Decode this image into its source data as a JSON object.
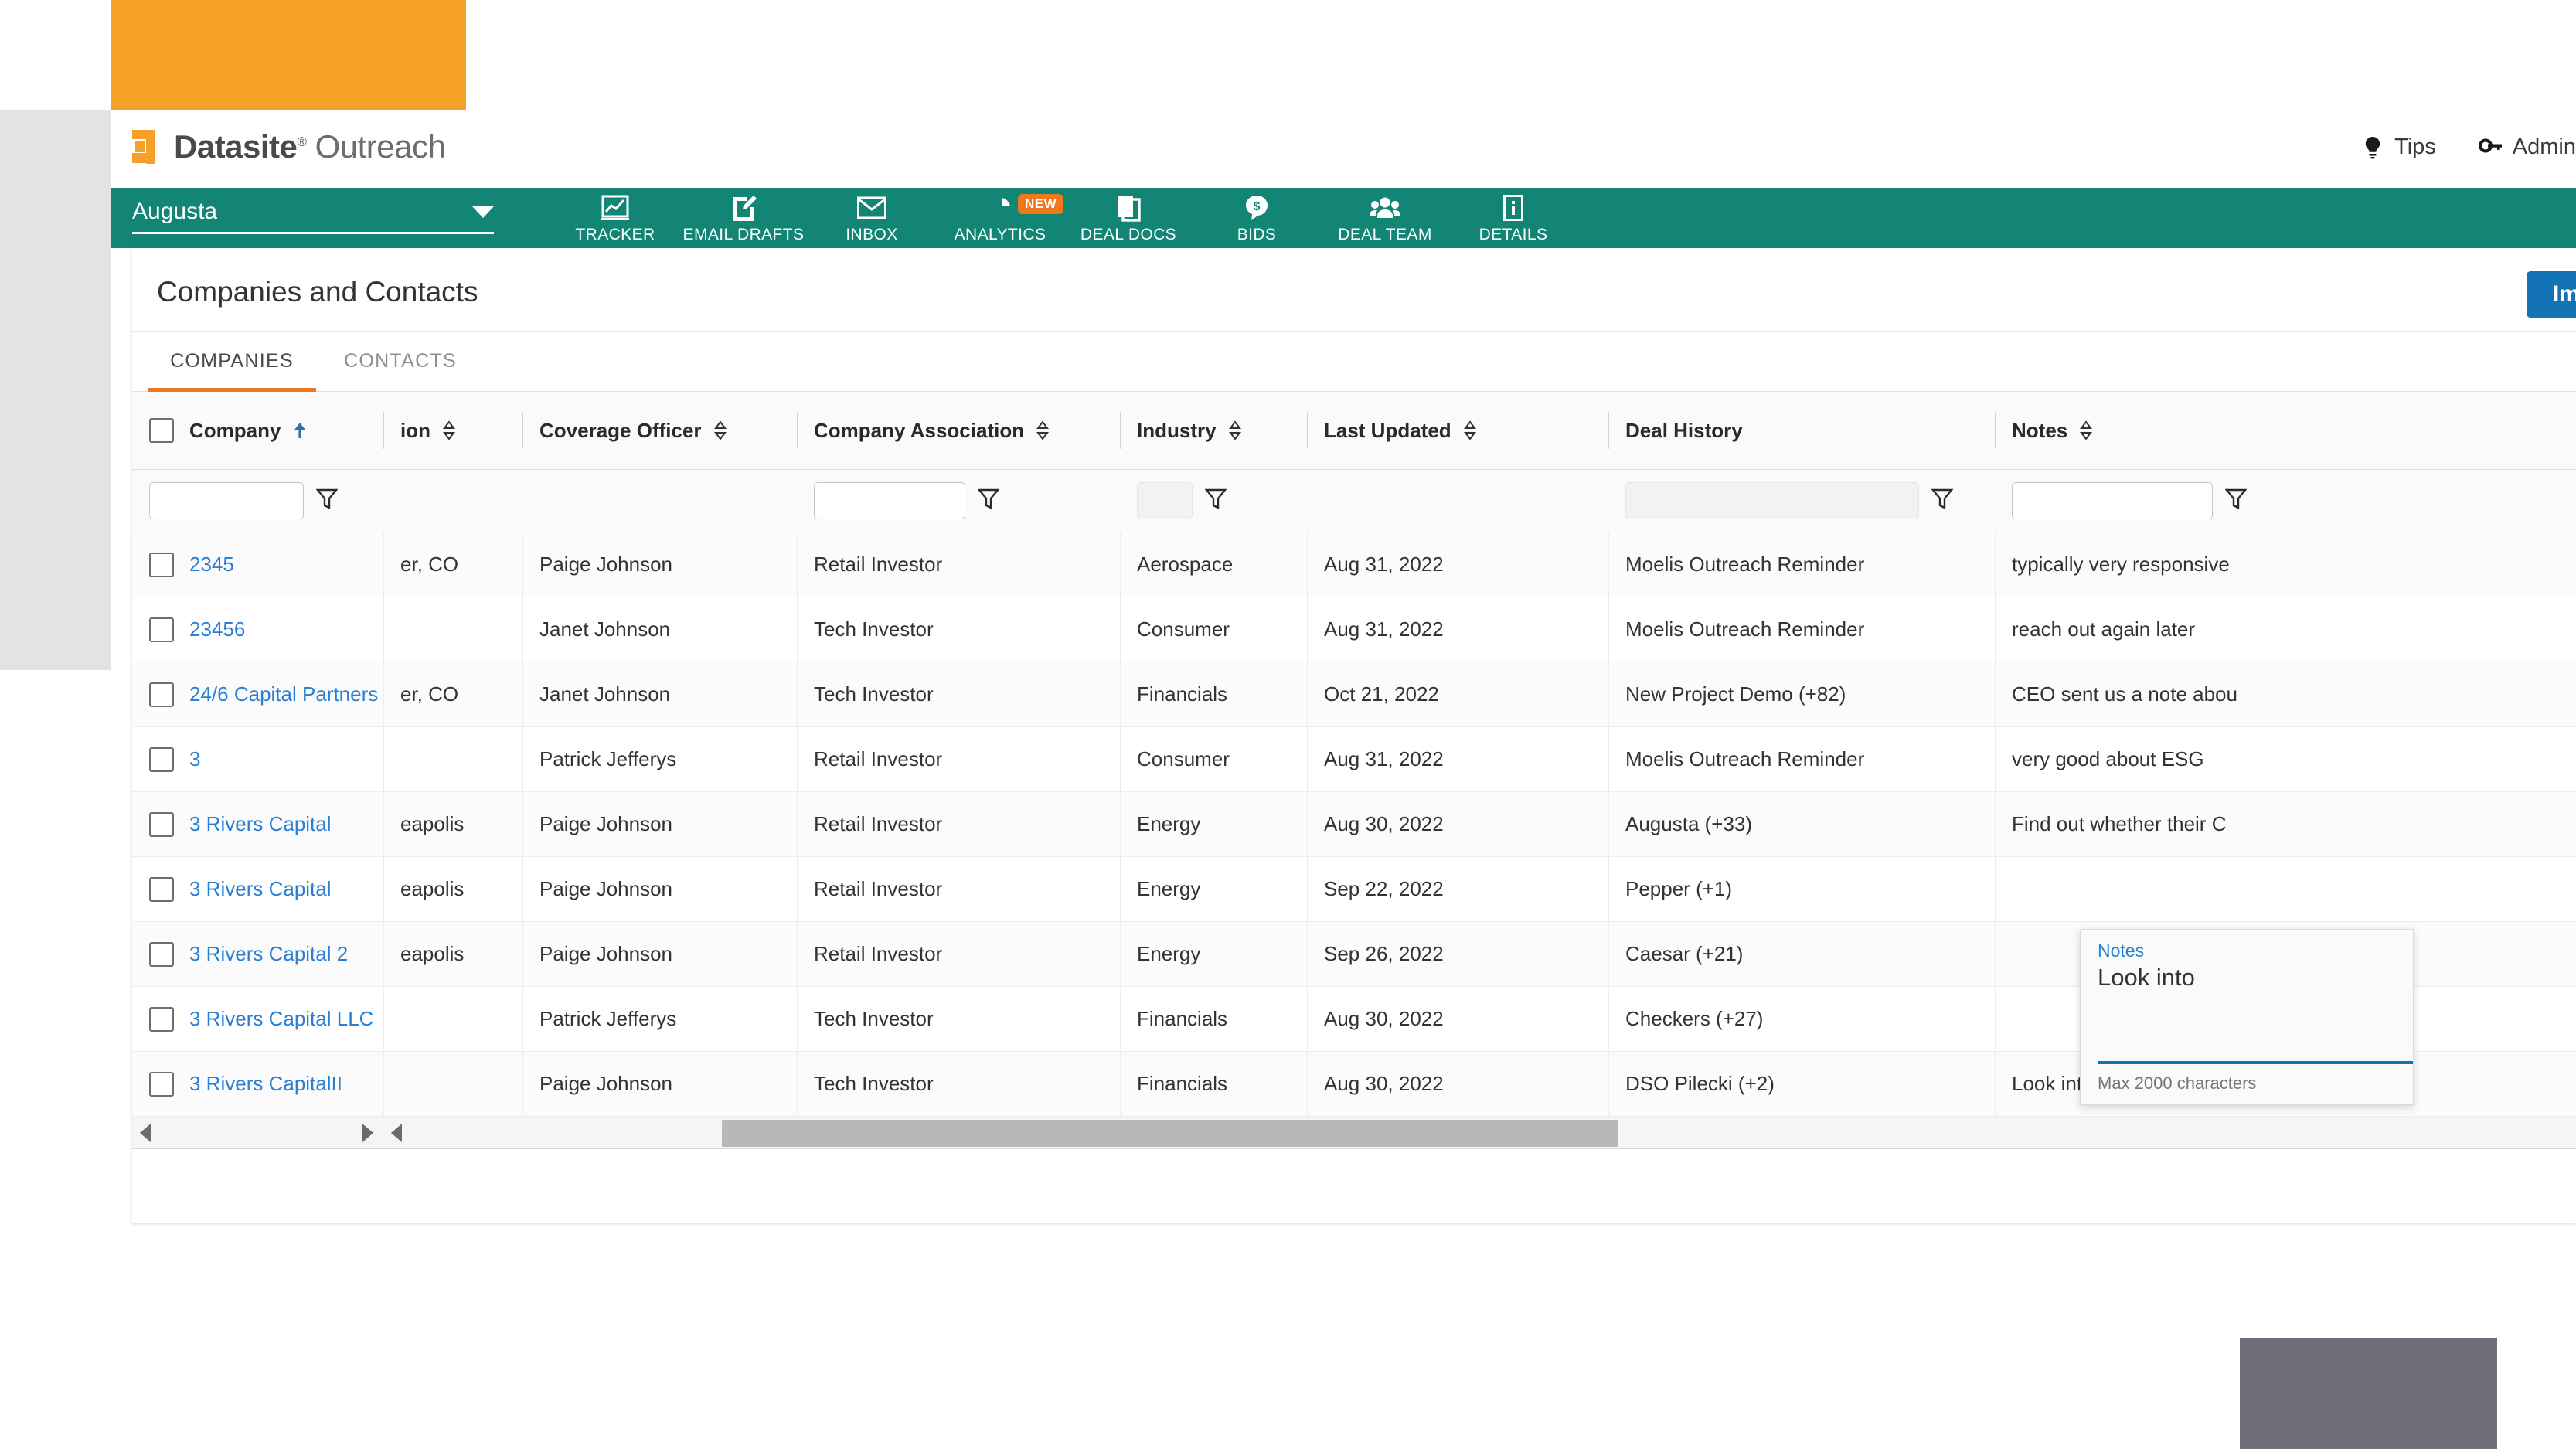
{
  "brand": {
    "name": "Datasite",
    "registered": "®",
    "product": "Outreach"
  },
  "topbar": {
    "tips_label": "Tips",
    "admin_label": "Admin",
    "tips_icon": "lightbulb-icon",
    "admin_icon": "key-icon"
  },
  "nav": {
    "deal_selected": "Augusta",
    "items": [
      {
        "label": "TRACKER",
        "icon": "chart-line-icon",
        "badge": null
      },
      {
        "label": "EMAIL DRAFTS",
        "icon": "compose-icon",
        "badge": null
      },
      {
        "label": "INBOX",
        "icon": "envelope-icon",
        "badge": null
      },
      {
        "label": "ANALYTICS",
        "icon": "pie-chart-icon",
        "badge": "NEW"
      },
      {
        "label": "DEAL DOCS",
        "icon": "documents-icon",
        "badge": null
      },
      {
        "label": "BIDS",
        "icon": "dollar-bubble-icon",
        "badge": null
      },
      {
        "label": "DEAL TEAM",
        "icon": "people-icon",
        "badge": null
      },
      {
        "label": "DETAILS",
        "icon": "info-icon",
        "badge": null
      }
    ]
  },
  "page": {
    "title": "Companies and Contacts",
    "import_label": "Import",
    "tabs": [
      {
        "label": "COMPANIES",
        "active": true
      },
      {
        "label": "CONTACTS",
        "active": false
      }
    ]
  },
  "table": {
    "columns": [
      {
        "key": "company",
        "label": "Company",
        "sort": "asc",
        "filter": "text",
        "filter_value": ""
      },
      {
        "key": "location",
        "label": "ion",
        "sort": "both",
        "filter": "none",
        "filter_value": ""
      },
      {
        "key": "coverage",
        "label": "Coverage Officer",
        "sort": "both",
        "filter": "none",
        "filter_value": ""
      },
      {
        "key": "assoc",
        "label": "Company Association",
        "sort": "both",
        "filter": "text",
        "filter_value": ""
      },
      {
        "key": "industry",
        "label": "Industry",
        "sort": "both",
        "filter": "disabled",
        "filter_value": ""
      },
      {
        "key": "updated",
        "label": "Last Updated",
        "sort": "both",
        "filter": "none",
        "filter_value": ""
      },
      {
        "key": "deal",
        "label": "Deal History",
        "sort": "none",
        "filter": "disabled",
        "filter_value": ""
      },
      {
        "key": "notes",
        "label": "Notes",
        "sort": "both",
        "filter": "text",
        "filter_value": ""
      }
    ],
    "rows": [
      {
        "company": "2345",
        "location": "er, CO",
        "coverage": "Paige Johnson",
        "assoc": "Retail Investor",
        "industry": "Aerospace",
        "updated": "Aug 31, 2022",
        "deal": "Moelis Outreach Reminder",
        "notes": "typically very responsive"
      },
      {
        "company": "23456",
        "location": "",
        "coverage": "Janet Johnson",
        "assoc": "Tech Investor",
        "industry": "Consumer",
        "updated": "Aug 31, 2022",
        "deal": "Moelis Outreach Reminder",
        "notes": "reach out again later"
      },
      {
        "company": "24/6 Capital Partners",
        "location": "er, CO",
        "coverage": "Janet Johnson",
        "assoc": "Tech Investor",
        "industry": "Financials",
        "updated": "Oct 21, 2022",
        "deal": "New Project Demo (+82)",
        "notes": "CEO sent us a note abou"
      },
      {
        "company": "3",
        "location": "",
        "coverage": "Patrick Jefferys",
        "assoc": "Retail Investor",
        "industry": "Consumer",
        "updated": "Aug 31, 2022",
        "deal": "Moelis Outreach Reminder",
        "notes": "very good about ESG"
      },
      {
        "company": "3 Rivers Capital",
        "location": "eapolis",
        "coverage": "Paige Johnson",
        "assoc": "Retail Investor",
        "industry": "Energy",
        "updated": "Aug 30, 2022",
        "deal": "Augusta (+33)",
        "notes": "Find out whether their C"
      },
      {
        "company": "3 Rivers Capital",
        "location": "eapolis",
        "coverage": "Paige Johnson",
        "assoc": "Retail Investor",
        "industry": "Energy",
        "updated": "Sep 22, 2022",
        "deal": "Pepper (+1)",
        "notes": ""
      },
      {
        "company": "3 Rivers Capital 2",
        "location": "eapolis",
        "coverage": "Paige Johnson",
        "assoc": "Retail Investor",
        "industry": "Energy",
        "updated": "Sep 26, 2022",
        "deal": "Caesar (+21)",
        "notes": ""
      },
      {
        "company": "3 Rivers Capital LLC",
        "location": "",
        "coverage": "Patrick Jefferys",
        "assoc": "Tech Investor",
        "industry": "Financials",
        "updated": "Aug 30, 2022",
        "deal": "Checkers (+27)",
        "notes": ""
      },
      {
        "company": "3 Rivers CapitalII",
        "location": "",
        "coverage": "Paige Johnson",
        "assoc": "Tech Investor",
        "industry": "Financials",
        "updated": "Aug 30, 2022",
        "deal": "DSO Pilecki (+2)",
        "notes": "Look into the latest me"
      }
    ]
  },
  "notes_popover": {
    "label": "Notes",
    "value": "Look into",
    "helper": "Max 2000 characters"
  },
  "colors": {
    "teal": "#128575",
    "orange": "#ef7622",
    "blue": "#1373b5",
    "link": "#2a7fd4",
    "yellow": "#fbe309",
    "gray_block": "#6e6e78"
  }
}
